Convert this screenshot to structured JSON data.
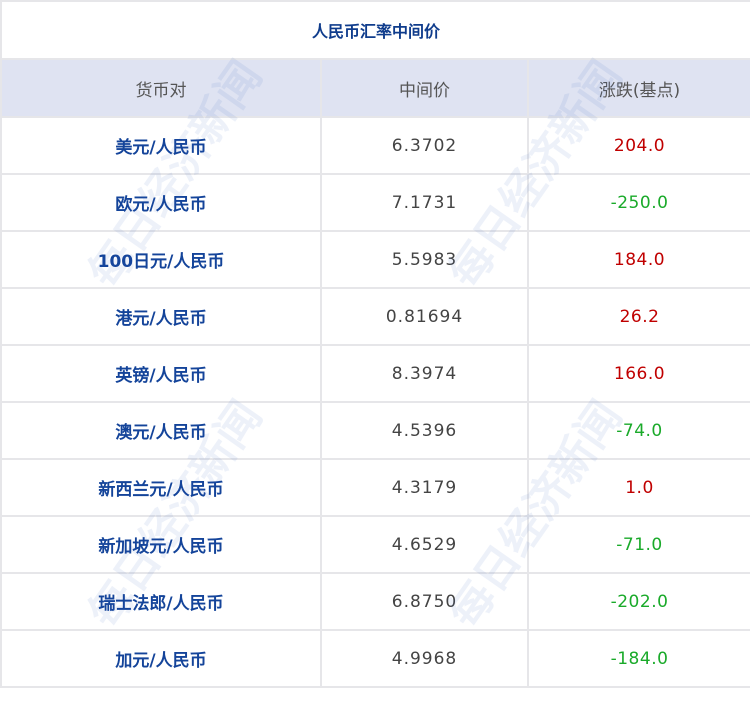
{
  "title": "人民币汇率中间价",
  "headers": [
    "货币对",
    "中间价",
    "涨跌(基点)"
  ],
  "rows": [
    {
      "pair": "美元/人民币",
      "mid": "6.3702",
      "change": "204.0",
      "direction": "up"
    },
    {
      "pair": "欧元/人民币",
      "mid": "7.1731",
      "change": "-250.0",
      "direction": "down"
    },
    {
      "pair": "100日元/人民币",
      "mid": "5.5983",
      "change": "184.0",
      "direction": "up"
    },
    {
      "pair": "港元/人民币",
      "mid": "0.81694",
      "change": "26.2",
      "direction": "up"
    },
    {
      "pair": "英镑/人民币",
      "mid": "8.3974",
      "change": "166.0",
      "direction": "up"
    },
    {
      "pair": "澳元/人民币",
      "mid": "4.5396",
      "change": "-74.0",
      "direction": "down"
    },
    {
      "pair": "新西兰元/人民币",
      "mid": "4.3179",
      "change": "1.0",
      "direction": "up"
    },
    {
      "pair": "新加坡元/人民币",
      "mid": "4.6529",
      "change": "-71.0",
      "direction": "down"
    },
    {
      "pair": "瑞士法郎/人民币",
      "mid": "6.8750",
      "change": "-202.0",
      "direction": "down"
    },
    {
      "pair": "加元/人民币",
      "mid": "4.9968",
      "change": "-184.0",
      "direction": "down"
    }
  ],
  "watermark": "每日经济新闻",
  "colors": {
    "up": "#c00000",
    "down": "#1aaa2a",
    "header_bg": "#dfe3f2",
    "pair_text": "#14449a"
  }
}
